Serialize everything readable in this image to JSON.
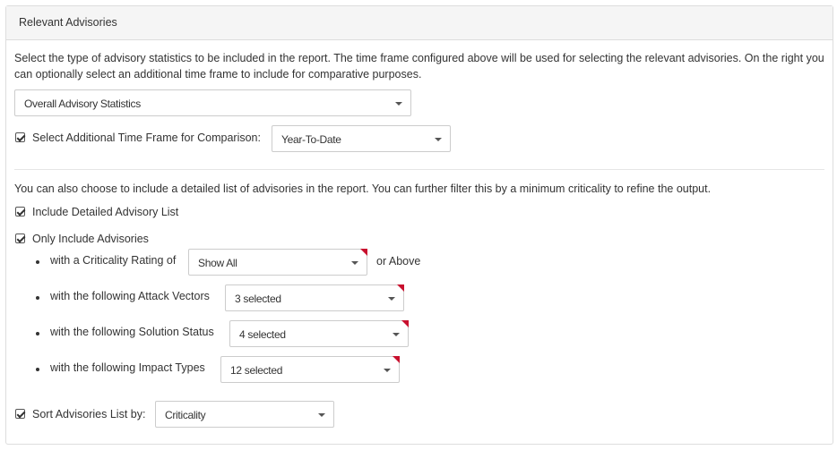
{
  "panel": {
    "title": "Relevant Advisories"
  },
  "statistics": {
    "description": "Select the type of advisory statistics to be included in the report. The time frame configured above will be used for selecting the relevant advisories. On the right you can optionally select an additional time frame to include for comparative purposes.",
    "type_select": {
      "value": "Overall Advisory Statistics"
    },
    "comparison": {
      "checked": true,
      "label": "Select Additional Time Frame for Comparison:",
      "select_value": "Year-To-Date"
    }
  },
  "detailed": {
    "description": "You can also choose to include a detailed list of advisories in the report. You can further filter this by a minimum criticality to refine the output.",
    "include_list": {
      "checked": true,
      "label": "Include Detailed Advisory List"
    },
    "only_include": {
      "checked": true,
      "label": "Only Include Advisories"
    },
    "filters": {
      "criticality": {
        "label": "with a Criticality Rating of",
        "value": "Show All",
        "suffix": "or Above"
      },
      "attack_vectors": {
        "label": "with the following Attack Vectors",
        "value": "3 selected"
      },
      "solution_status": {
        "label": "with the following Solution Status",
        "value": "4 selected"
      },
      "impact_types": {
        "label": "with the following Impact Types",
        "value": "12 selected"
      }
    },
    "sort": {
      "checked": true,
      "label": "Sort Advisories List by:",
      "value": "Criticality"
    }
  },
  "colors": {
    "modified_flag": "#c8102e",
    "header_bg": "#f5f5f5",
    "border": "#dddddd"
  }
}
